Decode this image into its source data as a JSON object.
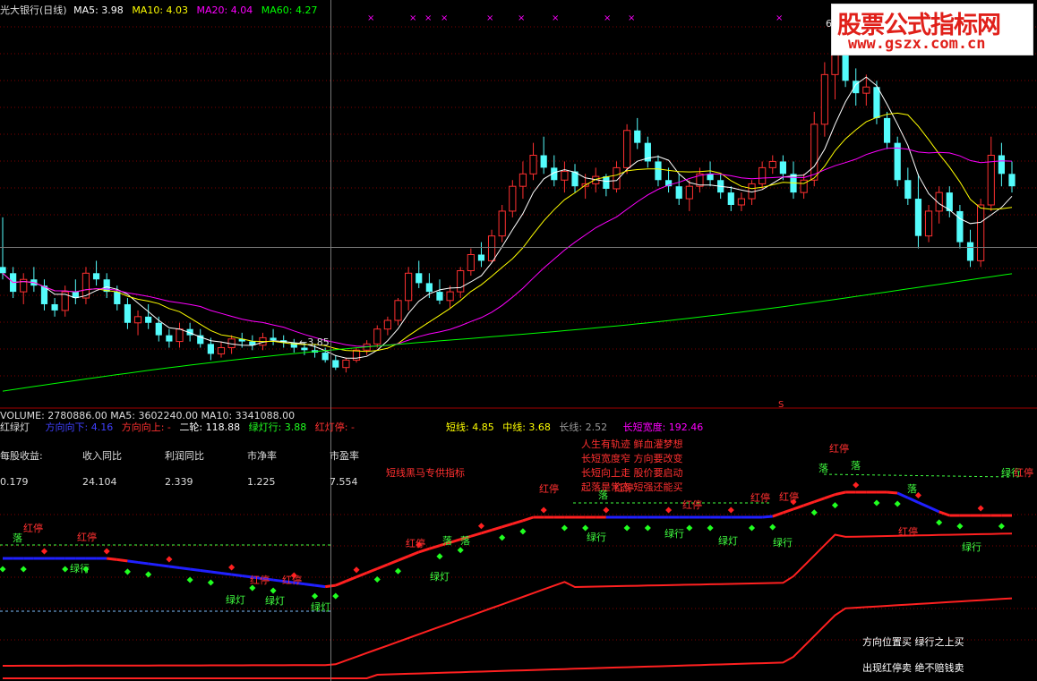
{
  "top_header": {
    "title": "光大银行(日线)",
    "ma5": "MA5: 3.98",
    "ma10": "MA10: 4.03",
    "ma20": "MA20: 4.04",
    "ma60": "MA60: 4.27"
  },
  "watermark": {
    "line1": "股票公式指标网",
    "line2": "www.gszx.com.cn"
  },
  "price_labels": {
    "low": "←3.85",
    "high": "6"
  },
  "volume_header": "VOLUME: 2780886.00  MA5: 3602240.00  MA10: 3341088.00",
  "sub_header": {
    "name": "红绿灯",
    "dir_down": "方向向下: 4.16",
    "dir_up": "方向向上: -",
    "erlun": "二轮: 118.88",
    "lvdeng": "绿灯行: 3.88",
    "hongdeng": "红灯停: -",
    "short": "短线: 4.85",
    "mid": "中线: 3.68",
    "long": "长线: 2.52",
    "width_label": "长短宽度: 192.46"
  },
  "fundamentals": {
    "headers": [
      "每股收益:",
      "收入同比",
      "利润同比",
      "市净率",
      "市盈率"
    ],
    "values": [
      "0.179",
      "24.104",
      "2.339",
      "1.225",
      "7.554"
    ]
  },
  "promo": "短线黑马专供指标",
  "poem": [
    "人生有轨迹 鲜血灌梦想",
    "长短宽度窄 方向要改变",
    "长短向上走 股价要启动",
    "起落是常态 短强还能买"
  ],
  "footer_notes": [
    "方向位置买 绿行之上买",
    "出现红停卖 绝不赔钱卖"
  ],
  "signals": [
    {
      "text": "红停",
      "kind": "red"
    },
    {
      "text": "落",
      "kind": "green"
    },
    {
      "text": "红停",
      "kind": "red"
    },
    {
      "text": "绿行",
      "kind": "green"
    },
    {
      "text": "绿灯",
      "kind": "green"
    },
    {
      "text": "红停",
      "kind": "red"
    },
    {
      "text": "绿灯",
      "kind": "green"
    },
    {
      "text": "红停",
      "kind": "red"
    },
    {
      "text": "绿灯",
      "kind": "green"
    },
    {
      "text": "红停",
      "kind": "red"
    },
    {
      "text": "落",
      "kind": "green"
    },
    {
      "text": "落",
      "kind": "green"
    },
    {
      "text": "绿灯",
      "kind": "green"
    },
    {
      "text": "红停",
      "kind": "red"
    },
    {
      "text": "落",
      "kind": "green"
    },
    {
      "text": "红停",
      "kind": "red"
    },
    {
      "text": "绿行",
      "kind": "green"
    },
    {
      "text": "红停",
      "kind": "red"
    },
    {
      "text": "绿行",
      "kind": "green"
    },
    {
      "text": "红停",
      "kind": "red"
    },
    {
      "text": "绿灯",
      "kind": "green"
    },
    {
      "text": "红停",
      "kind": "red"
    },
    {
      "text": "落",
      "kind": "green"
    },
    {
      "text": "绿行",
      "kind": "green"
    },
    {
      "text": "红停",
      "kind": "red"
    },
    {
      "text": "落",
      "kind": "green"
    },
    {
      "text": "落",
      "kind": "green"
    },
    {
      "text": "红停",
      "kind": "red"
    },
    {
      "text": "绿行",
      "kind": "green"
    },
    {
      "text": "绿行",
      "kind": "green"
    },
    {
      "text": "红停",
      "kind": "red"
    }
  ],
  "colors": {
    "up": "#ff3030",
    "down": "#54fcfc",
    "ma5": "#ffffff",
    "ma10": "#ffff00",
    "ma20": "#ff00ff",
    "ma60": "#00ff00",
    "red_line": "#ff2020",
    "blue_line": "#2020ff",
    "green_dot": "#20ff20",
    "grid": "#800000"
  },
  "chart_data": {
    "type": "candlestick",
    "title": "光大银行(日线)",
    "ohlc": [
      [
        4.55,
        4.95,
        4.45,
        4.5
      ],
      [
        4.5,
        4.55,
        4.3,
        4.35
      ],
      [
        4.35,
        4.5,
        4.25,
        4.45
      ],
      [
        4.45,
        4.55,
        4.35,
        4.4
      ],
      [
        4.4,
        4.45,
        4.2,
        4.25
      ],
      [
        4.25,
        4.3,
        4.15,
        4.2
      ],
      [
        4.2,
        4.4,
        4.15,
        4.35
      ],
      [
        4.35,
        4.45,
        4.25,
        4.3
      ],
      [
        4.3,
        4.55,
        4.25,
        4.5
      ],
      [
        4.5,
        4.6,
        4.4,
        4.45
      ],
      [
        4.45,
        4.5,
        4.3,
        4.35
      ],
      [
        4.35,
        4.4,
        4.2,
        4.25
      ],
      [
        4.25,
        4.3,
        4.05,
        4.1
      ],
      [
        4.1,
        4.2,
        4.0,
        4.15
      ],
      [
        4.15,
        4.25,
        4.05,
        4.1
      ],
      [
        4.1,
        4.15,
        3.95,
        4.0
      ],
      [
        4.0,
        4.05,
        3.9,
        3.95
      ],
      [
        3.95,
        4.1,
        3.9,
        4.05
      ],
      [
        4.05,
        4.1,
        3.95,
        4.0
      ],
      [
        4.0,
        4.05,
        3.9,
        3.93
      ],
      [
        3.93,
        3.98,
        3.8,
        3.85
      ],
      [
        3.85,
        3.95,
        3.82,
        3.9
      ],
      [
        3.9,
        4.0,
        3.85,
        3.97
      ],
      [
        3.97,
        4.02,
        3.9,
        3.95
      ],
      [
        3.95,
        4.0,
        3.88,
        3.92
      ],
      [
        3.92,
        4.02,
        3.88,
        3.98
      ],
      [
        3.98,
        4.05,
        3.92,
        3.96
      ],
      [
        3.96,
        4.0,
        3.9,
        3.94
      ],
      [
        3.94,
        3.97,
        3.86,
        3.9
      ],
      [
        3.9,
        3.94,
        3.84,
        3.88
      ],
      [
        3.88,
        3.92,
        3.82,
        3.86
      ],
      [
        3.86,
        3.9,
        3.78,
        3.8
      ],
      [
        3.8,
        3.84,
        3.72,
        3.74
      ],
      [
        3.74,
        3.82,
        3.7,
        3.8
      ],
      [
        3.8,
        3.9,
        3.78,
        3.88
      ],
      [
        3.88,
        3.96,
        3.84,
        3.93
      ],
      [
        3.93,
        4.08,
        3.9,
        4.05
      ],
      [
        4.05,
        4.15,
        4.0,
        4.12
      ],
      [
        4.12,
        4.3,
        4.08,
        4.28
      ],
      [
        4.28,
        4.55,
        4.2,
        4.5
      ],
      [
        4.5,
        4.6,
        4.38,
        4.42
      ],
      [
        4.42,
        4.5,
        4.3,
        4.35
      ],
      [
        4.35,
        4.45,
        4.25,
        4.28
      ],
      [
        4.28,
        4.4,
        4.22,
        4.35
      ],
      [
        4.35,
        4.55,
        4.3,
        4.52
      ],
      [
        4.52,
        4.7,
        4.48,
        4.65
      ],
      [
        4.65,
        4.75,
        4.55,
        4.6
      ],
      [
        4.6,
        4.85,
        4.58,
        4.8
      ],
      [
        4.8,
        5.05,
        4.75,
        5.0
      ],
      [
        5.0,
        5.25,
        4.95,
        5.2
      ],
      [
        5.2,
        5.4,
        5.1,
        5.3
      ],
      [
        5.3,
        5.55,
        5.25,
        5.45
      ],
      [
        5.45,
        5.6,
        5.3,
        5.35
      ],
      [
        5.35,
        5.45,
        5.2,
        5.25
      ],
      [
        5.25,
        5.4,
        5.15,
        5.32
      ],
      [
        5.32,
        5.38,
        5.15,
        5.2
      ],
      [
        5.2,
        5.3,
        5.1,
        5.22
      ],
      [
        5.22,
        5.35,
        5.15,
        5.28
      ],
      [
        5.28,
        5.3,
        5.12,
        5.18
      ],
      [
        5.18,
        5.4,
        5.15,
        5.35
      ],
      [
        5.35,
        5.7,
        5.3,
        5.65
      ],
      [
        5.65,
        5.75,
        5.5,
        5.55
      ],
      [
        5.55,
        5.6,
        5.35,
        5.4
      ],
      [
        5.4,
        5.45,
        5.2,
        5.25
      ],
      [
        5.25,
        5.35,
        5.15,
        5.2
      ],
      [
        5.2,
        5.3,
        5.05,
        5.1
      ],
      [
        5.1,
        5.25,
        5.0,
        5.2
      ],
      [
        5.2,
        5.35,
        5.15,
        5.3
      ],
      [
        5.3,
        5.4,
        5.2,
        5.25
      ],
      [
        5.25,
        5.3,
        5.1,
        5.15
      ],
      [
        5.15,
        5.2,
        5.0,
        5.05
      ],
      [
        5.05,
        5.15,
        5.0,
        5.1
      ],
      [
        5.1,
        5.25,
        5.05,
        5.22
      ],
      [
        5.22,
        5.4,
        5.18,
        5.35
      ],
      [
        5.35,
        5.45,
        5.3,
        5.4
      ],
      [
        5.4,
        5.45,
        5.25,
        5.3
      ],
      [
        5.3,
        5.4,
        5.1,
        5.15
      ],
      [
        5.15,
        5.3,
        5.1,
        5.25
      ],
      [
        5.25,
        5.8,
        5.2,
        5.7
      ],
      [
        5.7,
        6.2,
        5.6,
        6.1
      ],
      [
        6.1,
        6.45,
        5.9,
        6.3
      ],
      [
        6.3,
        6.4,
        6.0,
        6.05
      ],
      [
        6.05,
        6.15,
        5.85,
        5.95
      ],
      [
        5.95,
        6.1,
        5.85,
        6.0
      ],
      [
        6.0,
        6.05,
        5.7,
        5.75
      ],
      [
        5.75,
        5.8,
        5.5,
        5.55
      ],
      [
        5.55,
        5.6,
        5.2,
        5.25
      ],
      [
        5.25,
        5.35,
        5.05,
        5.1
      ],
      [
        5.1,
        5.3,
        4.7,
        4.8
      ],
      [
        4.8,
        5.05,
        4.75,
        5.0
      ],
      [
        5.0,
        5.2,
        4.9,
        5.15
      ],
      [
        5.15,
        5.2,
        4.95,
        5.0
      ],
      [
        5.0,
        5.05,
        4.7,
        4.75
      ],
      [
        4.75,
        4.85,
        4.55,
        4.6
      ],
      [
        4.6,
        5.1,
        4.55,
        5.05
      ],
      [
        5.05,
        5.6,
        5.0,
        5.45
      ],
      [
        5.45,
        5.55,
        5.2,
        5.3
      ],
      [
        5.3,
        5.4,
        5.15,
        5.2
      ]
    ],
    "xlabel": "",
    "ylabel": "",
    "ylim": [
      3.5,
      6.6
    ]
  }
}
